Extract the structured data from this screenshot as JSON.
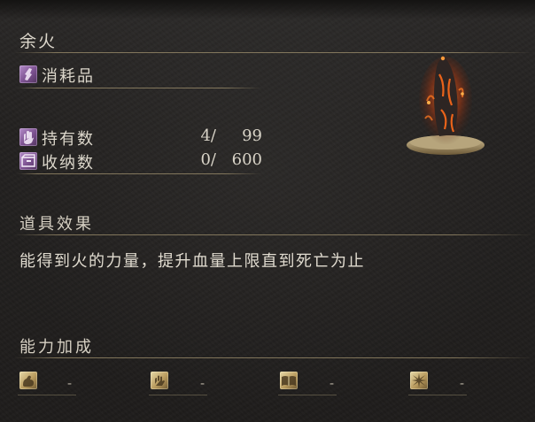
{
  "item": {
    "name": "余火",
    "category": "消耗品"
  },
  "stats": {
    "held": {
      "label": "持有数",
      "current": "4/",
      "max": "99"
    },
    "stored": {
      "label": "收纳数",
      "current": "0/",
      "max": "600"
    }
  },
  "effect": {
    "heading": "道具效果",
    "text": "能得到火的力量，提升血量上限直到死亡为止"
  },
  "scaling": {
    "heading": "能力加成",
    "slots": [
      {
        "icon": "strength-icon",
        "value": "-"
      },
      {
        "icon": "dexterity-icon",
        "value": "-"
      },
      {
        "icon": "intelligence-icon",
        "value": "-"
      },
      {
        "icon": "faith-icon",
        "value": "-"
      }
    ]
  },
  "colors": {
    "rule": "#a0916e",
    "text": "#dcd7cb",
    "background": "#211f1e",
    "category_icon": "#8a5ea0",
    "scaling_icon": "#c9ad6e"
  }
}
